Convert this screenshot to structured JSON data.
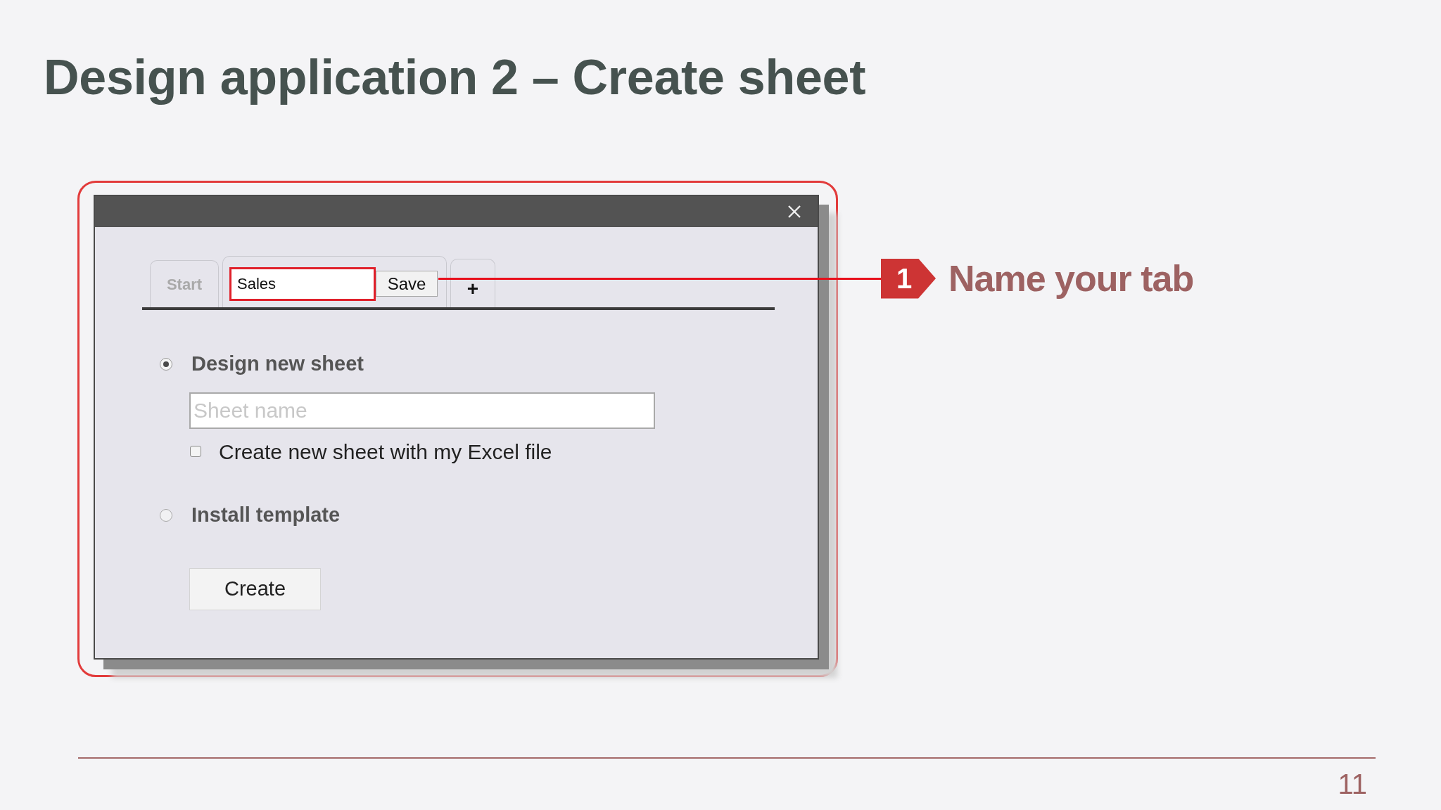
{
  "title": "Design application 2 – Create sheet",
  "dialog": {
    "tabs": [
      {
        "kind": "label",
        "label": "Start",
        "selected": false
      },
      {
        "kind": "rename",
        "value": "Sales",
        "highlighted": true,
        "button": "Save",
        "selected": true
      }
    ],
    "add_tab": {
      "label": "+"
    },
    "options": [
      {
        "label": "Design new sheet",
        "selected": true,
        "field": {
          "placeholder": "Sheet name"
        },
        "checkbox": {
          "label": "Create new sheet with my Excel file",
          "checked": false
        }
      },
      {
        "label": "Install template",
        "selected": false
      }
    ],
    "create_button": "Create"
  },
  "callout": {
    "number": "1",
    "text": "Name your tab"
  },
  "page_number": "11"
}
